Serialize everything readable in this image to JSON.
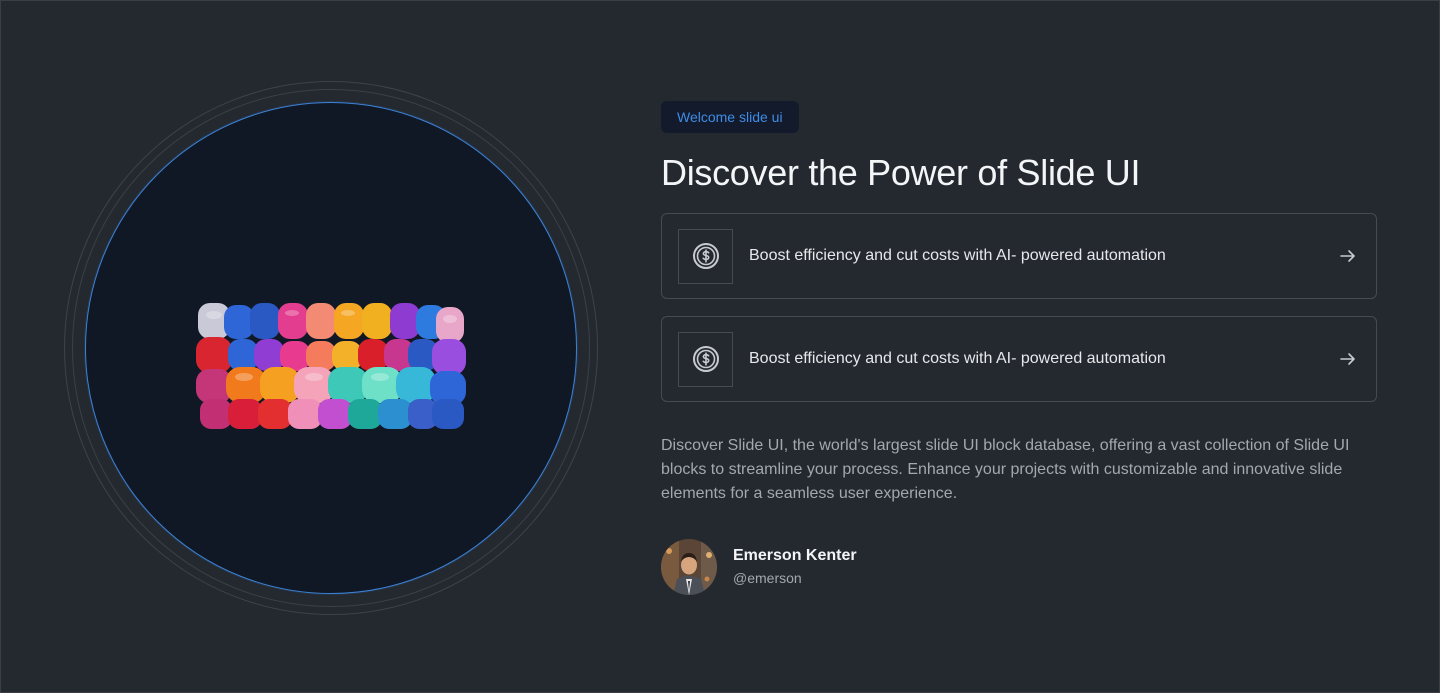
{
  "hero": {
    "image_alt": "colorful puffy sofa"
  },
  "badge": {
    "label": "Welcome slide ui"
  },
  "title": "Discover the Power of Slide UI",
  "features": [
    {
      "icon": "dollar-circle-icon",
      "text": "Boost efficiency and cut costs with AI- powered automation",
      "arrow_icon": "arrow-right-icon"
    },
    {
      "icon": "dollar-circle-icon",
      "text": "Boost efficiency and cut costs with AI- powered automation",
      "arrow_icon": "arrow-right-icon"
    }
  ],
  "description": "Discover Slide UI, the world's largest slide UI block database, offering a vast collection of Slide UI blocks to streamline your process. Enhance your projects with customizable and innovative slide elements for a seamless user experience.",
  "author": {
    "name": "Emerson Kenter",
    "handle": "@emerson"
  },
  "colors": {
    "background": "#242930",
    "accent": "#3f8ce6",
    "disc": "#101826"
  }
}
